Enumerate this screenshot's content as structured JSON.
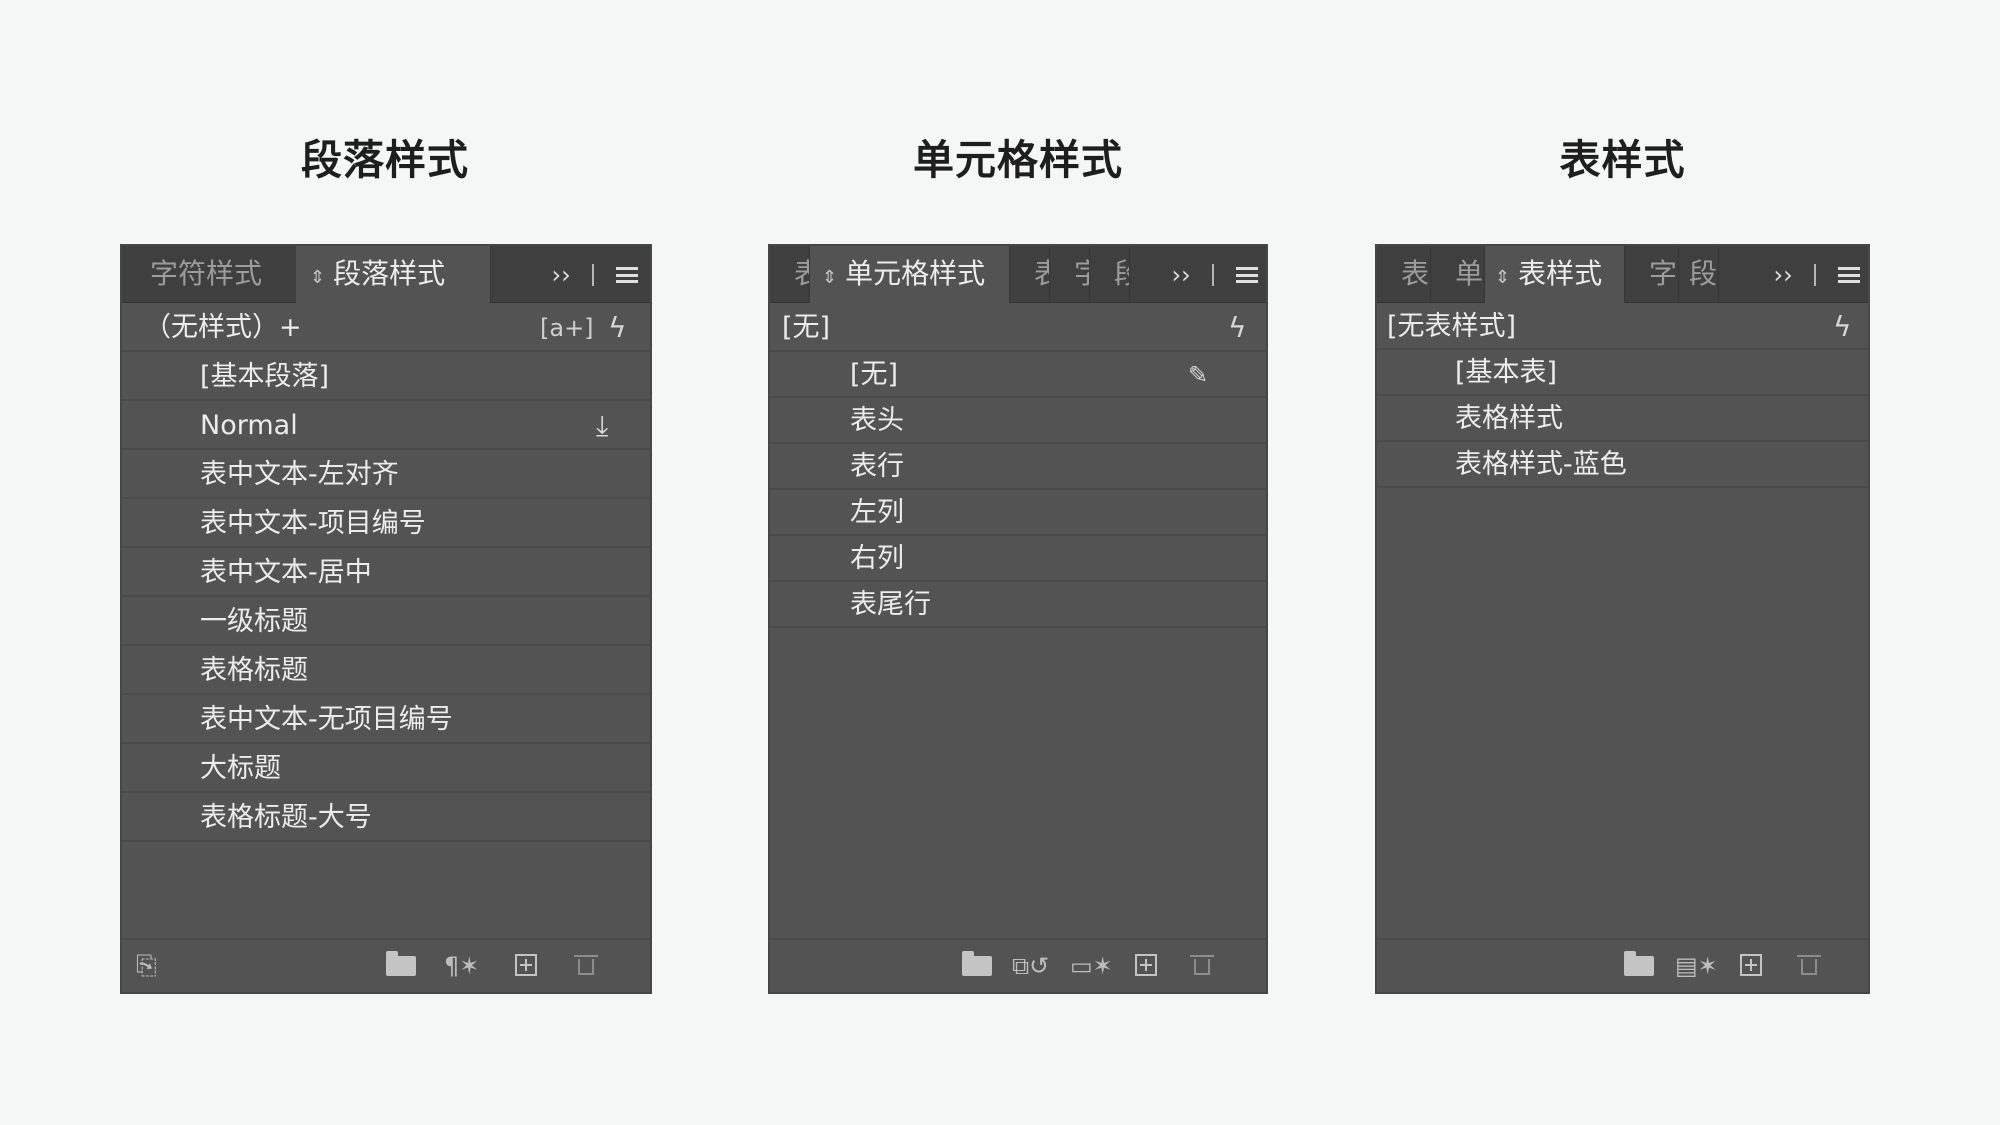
{
  "headings": {
    "paragraph": "段落样式",
    "cell": "单元格样式",
    "table": "表样式"
  },
  "paragraph_panel": {
    "tabs": [
      {
        "label": "字符样式",
        "active": false
      },
      {
        "label": "段落样式",
        "active": true
      }
    ],
    "top_row": {
      "label": "（无样式）+",
      "icons": [
        "new-style-group-icon",
        "lightning-icon"
      ]
    },
    "items": [
      {
        "label": "[基本段落]"
      },
      {
        "label": "Normal",
        "icon": "import-icon"
      },
      {
        "label": "表中文本-左对齐"
      },
      {
        "label": "表中文本-项目编号"
      },
      {
        "label": "表中文本-居中"
      },
      {
        "label": "一级标题"
      },
      {
        "label": "表格标题"
      },
      {
        "label": "表中文本-无项目编号"
      },
      {
        "label": "大标题"
      },
      {
        "label": "表格标题-大号"
      }
    ],
    "footer_icons": [
      "load-styles-icon",
      "folder-icon",
      "clear-override-icon",
      "new-style-icon",
      "trash-icon"
    ]
  },
  "cell_panel": {
    "tabs": [
      {
        "label": "表",
        "active": false
      },
      {
        "label": "单元格样式",
        "active": true
      },
      {
        "label": "表",
        "active": false
      },
      {
        "label": "字",
        "active": false
      },
      {
        "label": "段",
        "active": false
      }
    ],
    "top_row": {
      "label": "[无]",
      "icons": [
        "lightning-icon"
      ]
    },
    "items": [
      {
        "label": "[无]",
        "icon": "no-edit-icon"
      },
      {
        "label": "表头"
      },
      {
        "label": "表行"
      },
      {
        "label": "左列"
      },
      {
        "label": "右列"
      },
      {
        "label": "表尾行"
      }
    ],
    "footer_icons": [
      "folder-icon",
      "clear-attributes-icon",
      "clear-override-icon",
      "new-style-icon",
      "trash-icon"
    ]
  },
  "table_panel": {
    "tabs": [
      {
        "label": "表",
        "active": false
      },
      {
        "label": "单",
        "active": false
      },
      {
        "label": "表样式",
        "active": true
      },
      {
        "label": "字",
        "active": false
      },
      {
        "label": "段",
        "active": false
      }
    ],
    "top_row": {
      "label": "[无表样式]",
      "icons": [
        "lightning-icon"
      ]
    },
    "items": [
      {
        "label": "[基本表]"
      },
      {
        "label": "表格样式"
      },
      {
        "label": "表格样式-蓝色"
      }
    ],
    "footer_icons": [
      "folder-icon",
      "clear-override-icon",
      "new-style-icon",
      "trash-icon"
    ]
  },
  "colors": {
    "page_background": "#f5f7f6",
    "panel_background": "#535353",
    "tabbar_background": "#3f3f3f",
    "text": "#ececec"
  }
}
